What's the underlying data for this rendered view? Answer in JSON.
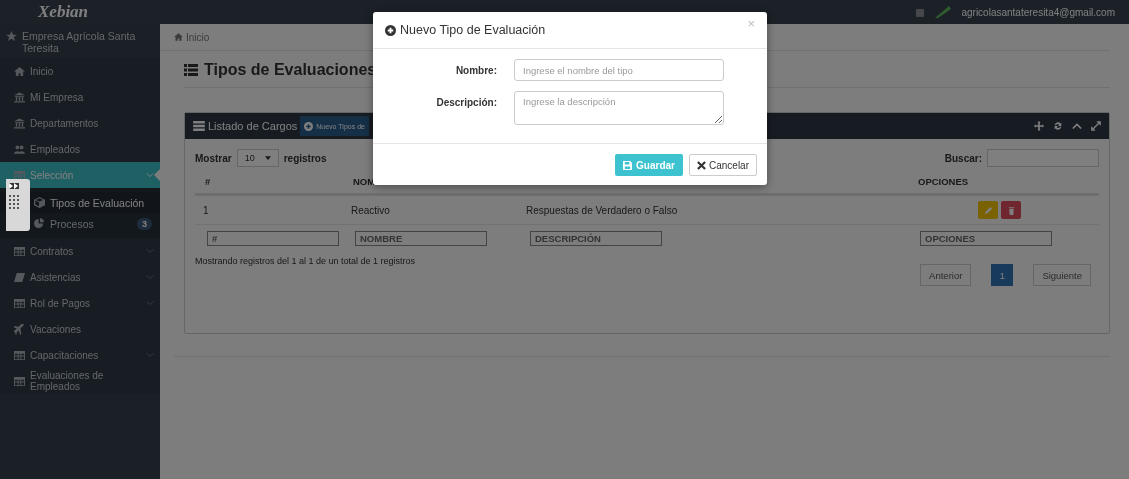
{
  "topbar": {
    "logo": "Xebian",
    "user_email": "agricolasantateresita4@gmail.com"
  },
  "sidebar": {
    "company": "Empresa Agrícola Santa Teresita",
    "items": [
      {
        "label": "Inicio",
        "kind": "home",
        "expandable": false,
        "selected": false
      },
      {
        "label": "Mi Empresa",
        "kind": "bank",
        "expandable": false,
        "selected": false
      },
      {
        "label": "Departamentos",
        "kind": "bank",
        "expandable": false,
        "selected": false
      },
      {
        "label": "Empleados",
        "kind": "users",
        "expandable": false,
        "selected": false
      },
      {
        "label": "Selección",
        "kind": "table",
        "expandable": true,
        "selected": true,
        "children": [
          {
            "label": "Tipos de Evaluación",
            "kind": "cube",
            "selected": true
          },
          {
            "label": "Procesos",
            "kind": "pie",
            "selected": false,
            "badge": "3"
          }
        ]
      },
      {
        "label": "Contratos",
        "kind": "table",
        "expandable": true,
        "selected": false
      },
      {
        "label": "Asistencias",
        "kind": "book",
        "expandable": true,
        "selected": false
      },
      {
        "label": "Rol de Pagos",
        "kind": "table",
        "expandable": true,
        "selected": false
      },
      {
        "label": "Vacaciones",
        "kind": "plane",
        "expandable": false,
        "selected": false
      },
      {
        "label": "Capacitaciones",
        "kind": "table",
        "expandable": true,
        "selected": false
      },
      {
        "label": "Evaluaciones de Empleados",
        "kind": "table",
        "expandable": false,
        "selected": false
      }
    ]
  },
  "breadcrumb": "Inicio",
  "page_title": "Tipos de Evaluaciones",
  "panel": {
    "title": "Listado de Cargos",
    "new_button": "Nuevo Tipos de",
    "show_label": "Mostrar",
    "page_size": "10",
    "records_label": "registros",
    "search_label": "Buscar:",
    "table": {
      "header": {
        "column_1": "#",
        "column_2": "NOM",
        "column_4": "OPCIONES"
      },
      "rows": [
        {
          "number": "1",
          "name": "Reactivo",
          "description": "Respuestas de Verdadero o Falso"
        }
      ],
      "filters": [
        "#",
        "NOMBRE",
        "DESCRIPCIÓN",
        "OPCIONES"
      ]
    },
    "info": "Mostrando registros del 1 al 1 de un total de 1 registros",
    "pagination": {
      "previous": "Anterior",
      "pages": [
        {
          "label": "1",
          "selected": true
        }
      ],
      "next": "Siguiente"
    }
  },
  "modal": {
    "title": "Nuevo Tipo de Evaluación",
    "close": "×",
    "fields": [
      {
        "label": "Nombre:",
        "kind": "input",
        "placeholder": "Ingrese el nombre del tipo"
      },
      {
        "label": "Descripción:",
        "kind": "textarea",
        "placeholder": "Ingrese la descripción"
      }
    ],
    "save": "Guardar",
    "cancel": "Cancelar"
  }
}
